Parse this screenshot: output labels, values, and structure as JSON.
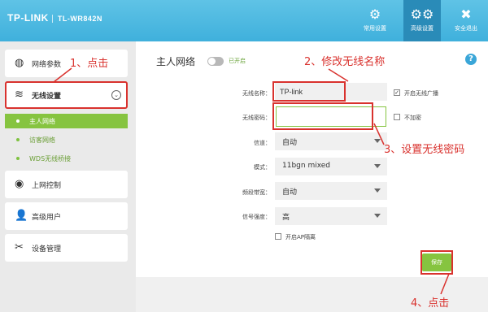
{
  "header": {
    "brand": "TP-LINK",
    "model": "TL-WR842N",
    "buttons": [
      {
        "icon": "gear-icon",
        "label": "常用设置"
      },
      {
        "icon": "gears-icon",
        "label": "高级设置"
      },
      {
        "icon": "close-icon",
        "label": "安全退出"
      }
    ],
    "active_index": 1
  },
  "sidebar": {
    "network_params": "网络参数",
    "wireless": "无线设置",
    "wireless_sub": [
      "主人网络",
      "访客网络",
      "WDS无线桥接"
    ],
    "internet_control": "上网控制",
    "advanced_users": "高级用户",
    "device_mgmt": "设备管理"
  },
  "main": {
    "title": "主人网络",
    "toggle_text": "已开启",
    "help": "?",
    "ssid_label": "无线名称：",
    "ssid_value": "TP-link",
    "broadcast_label": "开启无线广播",
    "pwd_label": "无线密码：",
    "pwd_value": "",
    "no_encrypt_label": "不加密",
    "channel_label": "信道：",
    "channel_value": "自动",
    "mode_label": "模式：",
    "mode_value": "11bgn mixed",
    "bandwidth_label": "频段带宽：",
    "bandwidth_value": "自动",
    "signal_label": "信号强度：",
    "signal_value": "高",
    "ap_isolation_label": "开启AP隔离",
    "save_label": "保存"
  },
  "annotations": {
    "step1": "1、点击",
    "step2": "2、修改无线名称",
    "step3": "3、设置无线密码",
    "step4": "4、点击"
  },
  "colors": {
    "header": "#48b6df",
    "accent_green": "#86c440",
    "annotation_red": "#d9322e"
  }
}
